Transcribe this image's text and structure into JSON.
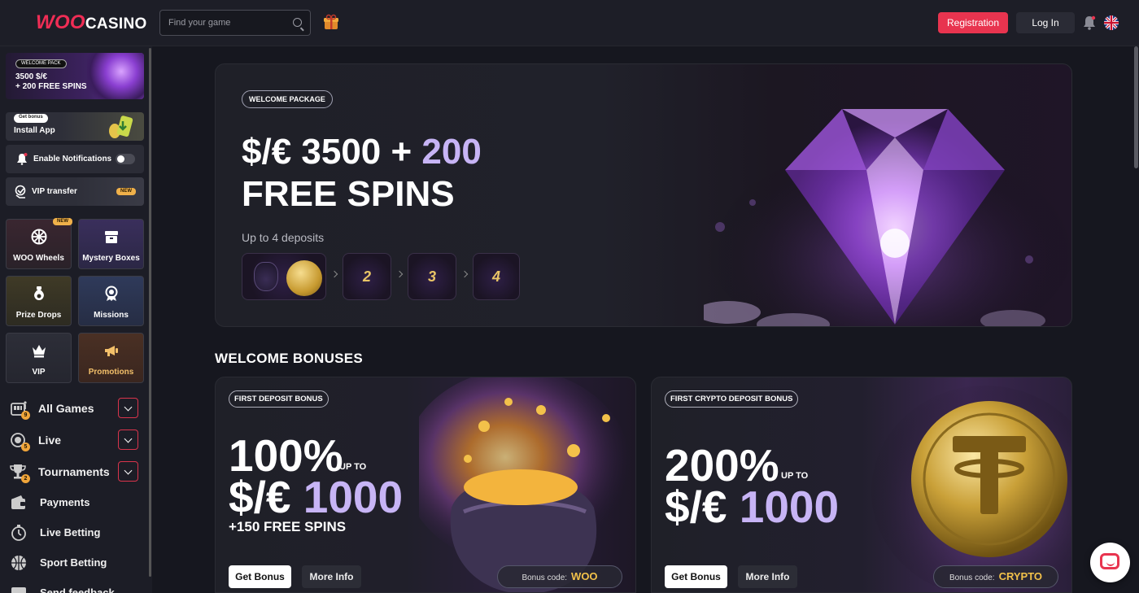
{
  "header": {
    "logo_woo": "WOO",
    "logo_casino": "CASINO",
    "search_placeholder": "Find your game",
    "register_label": "Registration",
    "login_label": "Log In"
  },
  "sidebar": {
    "welcome_pack": {
      "badge": "WELCOME PACK",
      "line1": "3500 $/€",
      "line2": "+ 200 FREE SPINS"
    },
    "install": {
      "badge": "Get bonus",
      "label": "Install App"
    },
    "notifications": {
      "label": "Enable Notifications",
      "enabled": false
    },
    "vip_transfer": {
      "label": "VIP transfer",
      "badge": "NEW"
    },
    "tiles": [
      {
        "label": "WOO Wheels",
        "badge": "NEW",
        "icon": "wheel-icon"
      },
      {
        "label": "Mystery Boxes",
        "icon": "box-icon"
      },
      {
        "label": "Prize Drops",
        "icon": "drop-icon"
      },
      {
        "label": "Missions",
        "icon": "medal-icon"
      },
      {
        "label": "VIP",
        "icon": "crown-icon"
      },
      {
        "label": "Promotions",
        "icon": "megaphone-icon"
      }
    ],
    "nav": [
      {
        "label": "All Games",
        "count": "9",
        "icon": "slot-machine-icon"
      },
      {
        "label": "Live",
        "count": "5",
        "icon": "live-icon"
      },
      {
        "label": "Tournaments",
        "count": "2",
        "icon": "trophy-icon"
      },
      {
        "label": "Payments",
        "icon": "wallet-icon"
      },
      {
        "label": "Live Betting",
        "icon": "stopwatch-icon"
      },
      {
        "label": "Sport Betting",
        "icon": "ball-icon"
      },
      {
        "label": "Send feedback",
        "icon": "feedback-icon"
      }
    ]
  },
  "hero": {
    "badge": "WELCOME PACKAGE",
    "title_part1": "$/€ 3500 + ",
    "title_highlight": "200",
    "title_line2": "FREE SPINS",
    "subtitle": "Up to 4 deposits",
    "deposits": [
      "",
      "2",
      "3",
      "4"
    ]
  },
  "bonuses": {
    "section_title": "WELCOME BONUSES",
    "cards": [
      {
        "badge": "FIRST DEPOSIT BONUS",
        "percent": "100%",
        "upto": "UP TO",
        "amount_prefix": "$/€ ",
        "amount": "1000",
        "extra": "+150 FREE SPINS",
        "get_label": "Get Bonus",
        "more_label": "More Info",
        "code_label": "Bonus code:",
        "code_value": "WOO"
      },
      {
        "badge": "FIRST CRYPTO DEPOSIT BONUS",
        "percent": "200%",
        "upto": "UP TO",
        "amount_prefix": "$/€ ",
        "amount": "1000",
        "get_label": "Get Bonus",
        "more_label": "More Info",
        "code_label": "Bonus code:",
        "code_value": "CRYPTO"
      }
    ]
  },
  "colors": {
    "accent": "#e8344f",
    "lavender": "#c7b4f5",
    "gold": "#f2c14a",
    "background": "#16171f"
  }
}
